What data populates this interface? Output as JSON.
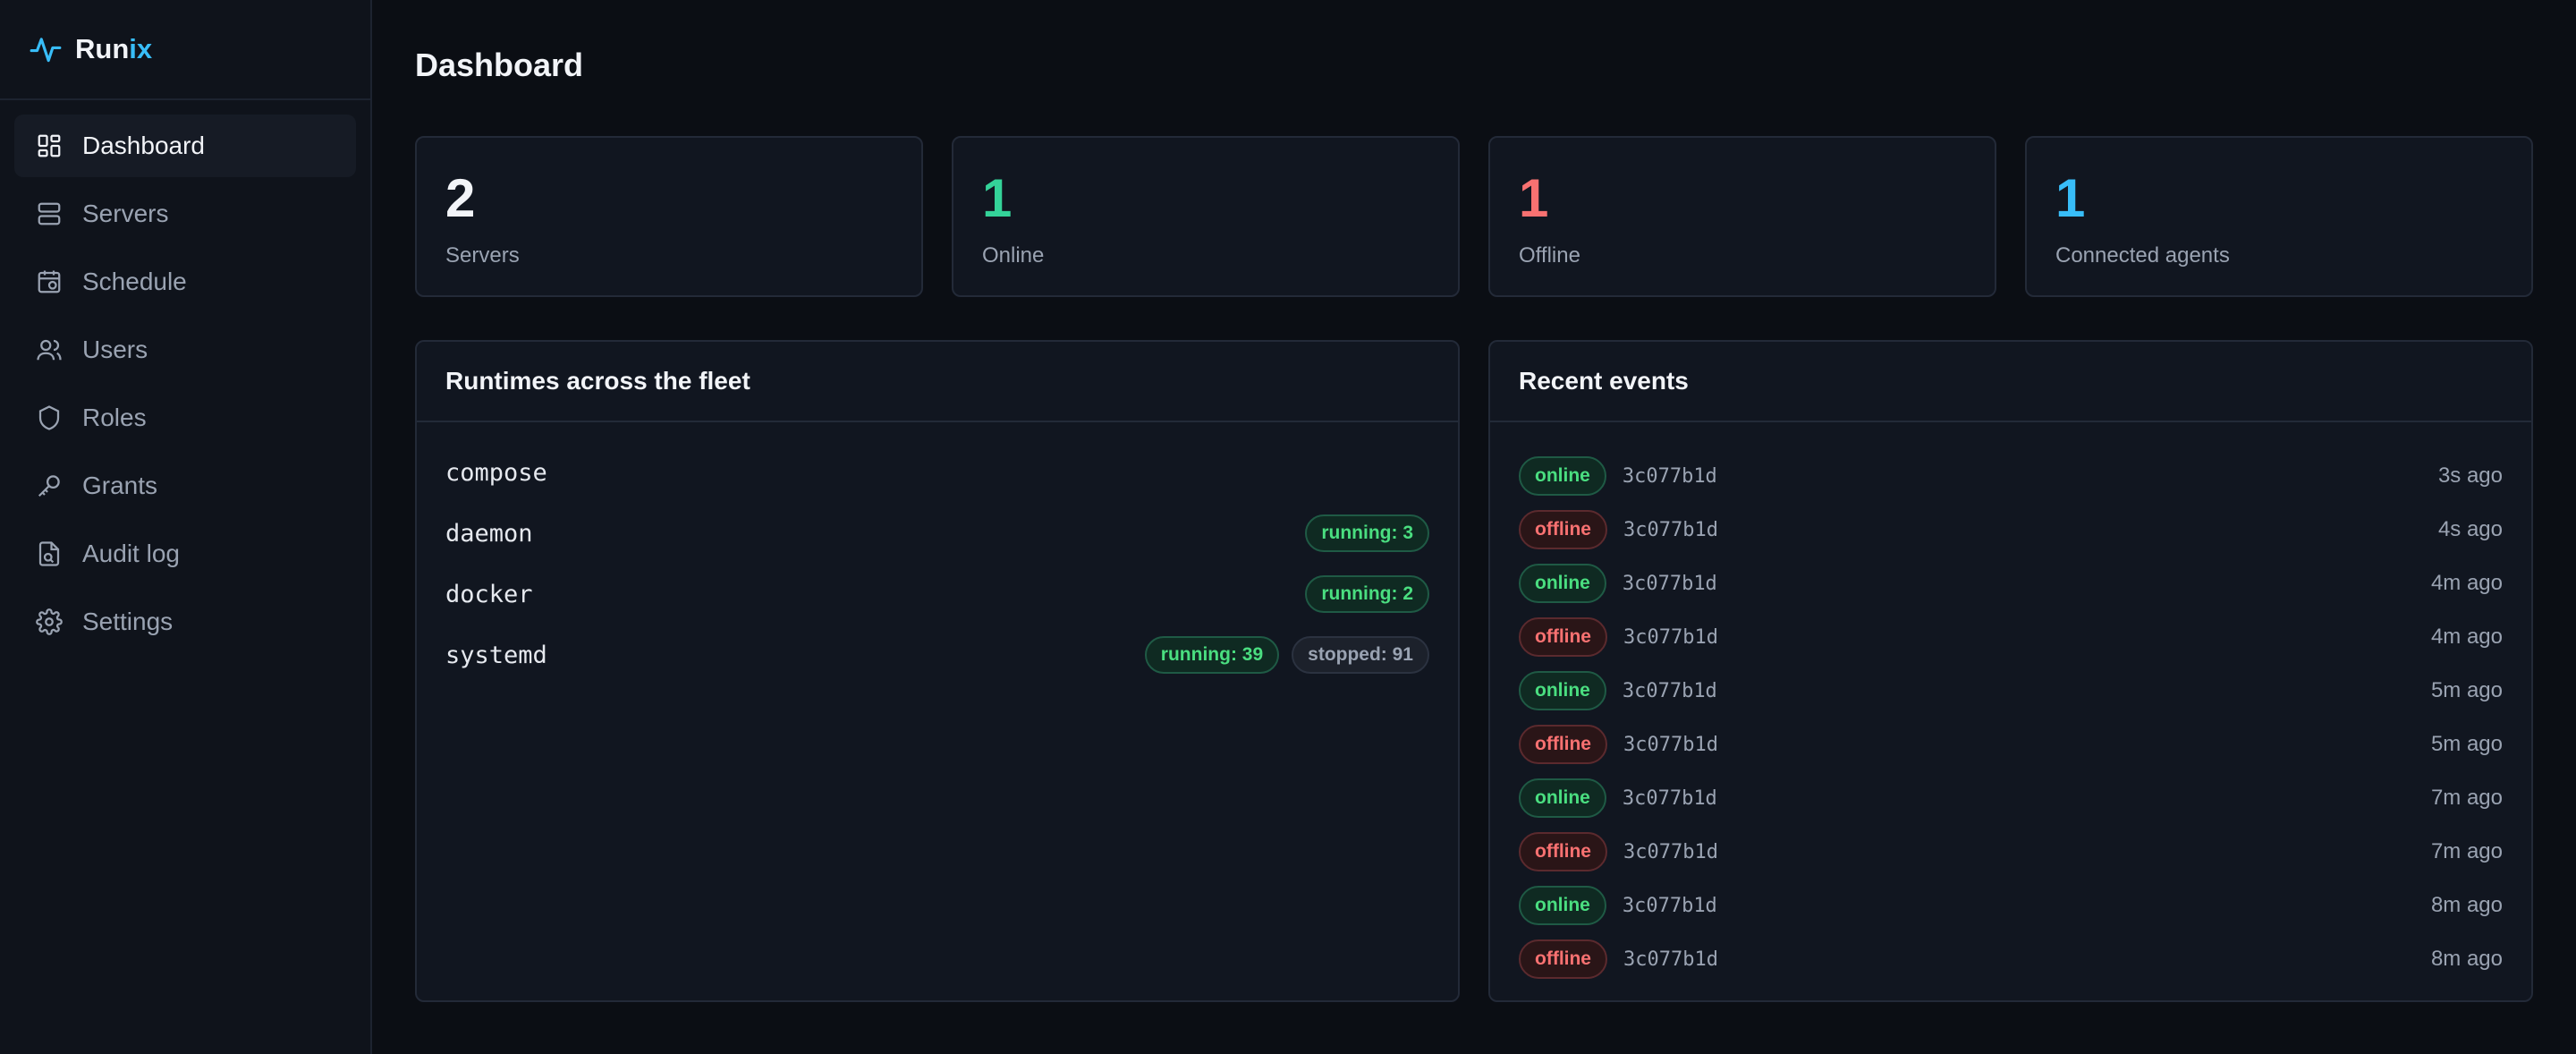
{
  "brand": {
    "name_main": "Run",
    "name_accent": "ix"
  },
  "colors": {
    "accent": "#38bdf8",
    "success": "#34d399",
    "danger": "#f87171",
    "info": "#38bdf8"
  },
  "sidebar": {
    "items": [
      {
        "label": "Dashboard",
        "icon": "dashboard-icon",
        "active": true
      },
      {
        "label": "Servers",
        "icon": "servers-icon"
      },
      {
        "label": "Schedule",
        "icon": "calendar-icon"
      },
      {
        "label": "Users",
        "icon": "users-icon"
      },
      {
        "label": "Roles",
        "icon": "shield-icon"
      },
      {
        "label": "Grants",
        "icon": "key-icon"
      },
      {
        "label": "Audit log",
        "icon": "audit-icon"
      },
      {
        "label": "Settings",
        "icon": "gear-icon"
      }
    ]
  },
  "page": {
    "title": "Dashboard"
  },
  "stats": [
    {
      "value": "2",
      "label": "Servers",
      "color": "#f2f4f8"
    },
    {
      "value": "1",
      "label": "Online",
      "color": "#34d399"
    },
    {
      "value": "1",
      "label": "Offline",
      "color": "#f87171"
    },
    {
      "value": "1",
      "label": "Connected agents",
      "color": "#38bdf8"
    }
  ],
  "runtimes": {
    "title": "Runtimes across the fleet",
    "rows": [
      {
        "name": "compose",
        "badges": []
      },
      {
        "name": "daemon",
        "badges": [
          {
            "text": "running: 3",
            "kind": "running"
          }
        ]
      },
      {
        "name": "docker",
        "badges": [
          {
            "text": "running: 2",
            "kind": "running"
          }
        ]
      },
      {
        "name": "systemd",
        "badges": [
          {
            "text": "running: 39",
            "kind": "running"
          },
          {
            "text": "stopped: 91",
            "kind": "stopped"
          }
        ]
      }
    ]
  },
  "events": {
    "title": "Recent events",
    "rows": [
      {
        "status": "online",
        "id": "3c077b1d",
        "time": "3s ago"
      },
      {
        "status": "offline",
        "id": "3c077b1d",
        "time": "4s ago"
      },
      {
        "status": "online",
        "id": "3c077b1d",
        "time": "4m ago"
      },
      {
        "status": "offline",
        "id": "3c077b1d",
        "time": "4m ago"
      },
      {
        "status": "online",
        "id": "3c077b1d",
        "time": "5m ago"
      },
      {
        "status": "offline",
        "id": "3c077b1d",
        "time": "5m ago"
      },
      {
        "status": "online",
        "id": "3c077b1d",
        "time": "7m ago"
      },
      {
        "status": "offline",
        "id": "3c077b1d",
        "time": "7m ago"
      },
      {
        "status": "online",
        "id": "3c077b1d",
        "time": "8m ago"
      },
      {
        "status": "offline",
        "id": "3c077b1d",
        "time": "8m ago"
      }
    ]
  }
}
